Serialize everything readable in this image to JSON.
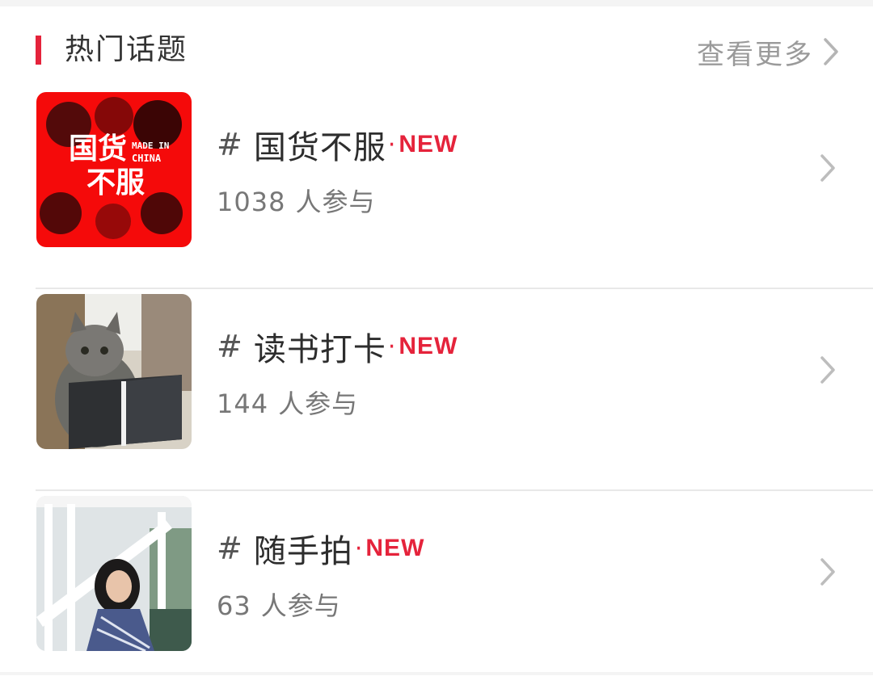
{
  "header": {
    "title": "热门话题",
    "more_label": "查看更多",
    "accent_color": "#e5233b"
  },
  "topics": [
    {
      "hash": "#",
      "name": "国货不服",
      "dot": "·",
      "tag": "NEW",
      "count": "1038",
      "count_suffix": "人参与",
      "thumb_icon": "made-in-china-poster"
    },
    {
      "hash": "#",
      "name": "读书打卡",
      "dot": "·",
      "tag": "NEW",
      "count": "144",
      "count_suffix": "人参与",
      "thumb_icon": "cat-reading-book"
    },
    {
      "hash": "#",
      "name": "随手拍",
      "dot": "·",
      "tag": "NEW",
      "count": "63",
      "count_suffix": "人参与",
      "thumb_icon": "woman-on-stairs-photo"
    }
  ],
  "thumb_text": {
    "big_line1": "国货",
    "big_line2": "不服",
    "small_line1": "MADE IN",
    "small_line2": "CHINA"
  }
}
